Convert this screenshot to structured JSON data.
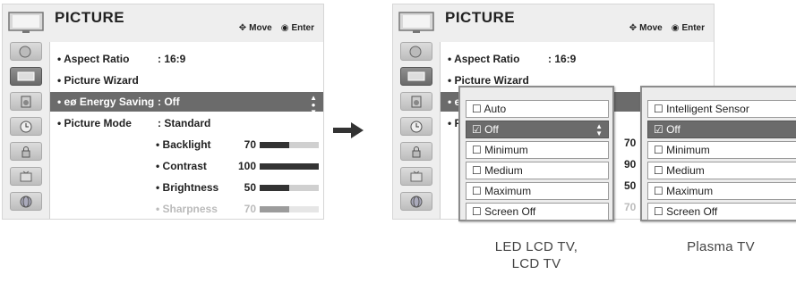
{
  "left_panel": {
    "title": "PICTURE",
    "hint_move": "Move",
    "hint_enter": "Enter",
    "menu": [
      {
        "label": "• Aspect Ratio",
        "value": ": 16:9"
      },
      {
        "label": "• Picture Wizard",
        "value": ""
      },
      {
        "label": "• eø Energy Saving",
        "value": ": Off"
      },
      {
        "label": "• Picture Mode",
        "value": ": Standard"
      }
    ],
    "settings": [
      {
        "label": "• Backlight",
        "value": "70",
        "level": 0.5
      },
      {
        "label": "• Contrast",
        "value": "100",
        "level": 1.0
      },
      {
        "label": "• Brightness",
        "value": "50",
        "level": 0.5
      },
      {
        "label": "• Sharpness",
        "value": "70",
        "level": 0.5
      }
    ]
  },
  "right_panel": {
    "title": "PICTURE",
    "hint_move": "Move",
    "hint_enter": "Enter",
    "menu": [
      {
        "label": "• Aspect Ratio",
        "value": ": 16:9"
      },
      {
        "label": "• Picture Wizard"
      },
      {
        "label": "• e"
      },
      {
        "label": "• P"
      }
    ],
    "visible_values": [
      "70",
      "90",
      "50",
      "70"
    ]
  },
  "popup_led": {
    "options": [
      "Auto",
      "Off",
      "Minimum",
      "Medium",
      "Maximum",
      "Screen Off"
    ],
    "checked": "Off"
  },
  "popup_plasma": {
    "options": [
      "Intelligent Sensor",
      "Off",
      "Minimum",
      "Medium",
      "Maximum",
      "Screen Off"
    ],
    "checked": "Off"
  },
  "captions": {
    "led_line1": "LED LCD TV,",
    "led_line2": "LCD TV",
    "plasma": "Plasma TV"
  },
  "colors": {
    "highlight": "#6b6b6b",
    "panel_bg": "#eeeeee",
    "arrow": "#333333"
  }
}
